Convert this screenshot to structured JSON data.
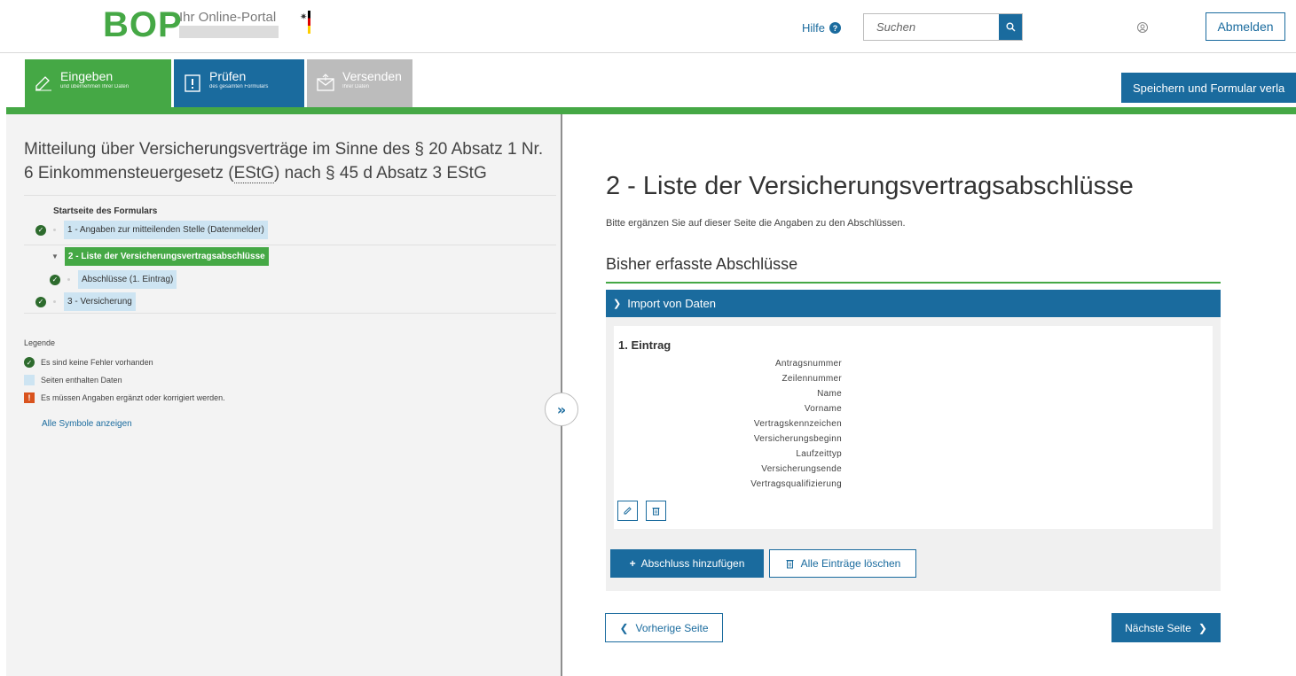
{
  "header": {
    "logo": "BOP",
    "portal_name": "Ihr Online-Portal",
    "help_label": "Hilfe",
    "help_icon": "?",
    "search_placeholder": "Suchen",
    "logout_label": "Abmelden"
  },
  "steps": [
    {
      "title": "Eingeben",
      "subtitle": "und übernehmen Ihrer Daten",
      "color": "#45a845"
    },
    {
      "title": "Prüfen",
      "subtitle": "des gesamten Formulars",
      "color": "#1a6b9e"
    },
    {
      "title": "Versenden",
      "subtitle": "Ihrer Daten",
      "color": "#bcbcbc"
    }
  ],
  "save_button_label": "Speichern und Formular verla",
  "form": {
    "title_part1": "Mitteilung über Versicherungsverträge im Sinne des § 20 Absatz 1 Nr. 6 Einkommensteuergesetz (",
    "title_abbr": "EStG",
    "title_part2": ") nach § 45 d Absatz 3 EStG"
  },
  "nav": {
    "start_label": "Startseite des Formulars",
    "items": [
      {
        "label": "1 - Angaben zur mitteilenden Stelle (Datenmelder)",
        "status": "ok"
      },
      {
        "label": "2 - Liste der Versicherungsvertragsabschlüsse",
        "status": "active"
      },
      {
        "label": "Abschlüsse (1. Eintrag)",
        "status": "ok"
      },
      {
        "label": "3 - Versicherung",
        "status": "ok"
      }
    ]
  },
  "legend": {
    "title": "Legende",
    "no_errors": "Es sind keine Fehler vorhanden",
    "has_data": "Seiten enthalten Daten",
    "needs_fix": "Es müssen Angaben ergänzt oder korrigiert werden.",
    "show_all": "Alle Symbole anzeigen"
  },
  "main": {
    "page_title": "2 - Liste der Versicherungsvertragsabschlüsse",
    "intro": "Bitte ergänzen Sie auf dieser Seite die Angaben zu den Abschlüssen.",
    "section_title": "Bisher erfasste Abschlüsse",
    "import_label": "Import von Daten",
    "entry_title": "1. Eintrag",
    "entry_fields": [
      "Antragsnummer",
      "Zeilennummer",
      "Name",
      "Vorname",
      "Vertragskennzeichen",
      "Versicherungsbeginn",
      "Laufzeittyp",
      "Versicherungsende",
      "Vertragsqualifizierung"
    ],
    "add_label": "Abschluss hinzufügen",
    "add_prefix": "+",
    "delete_all_label": "Alle Einträge löschen",
    "prev_label": "Vorherige Seite",
    "next_label": "Nächste Seite"
  }
}
